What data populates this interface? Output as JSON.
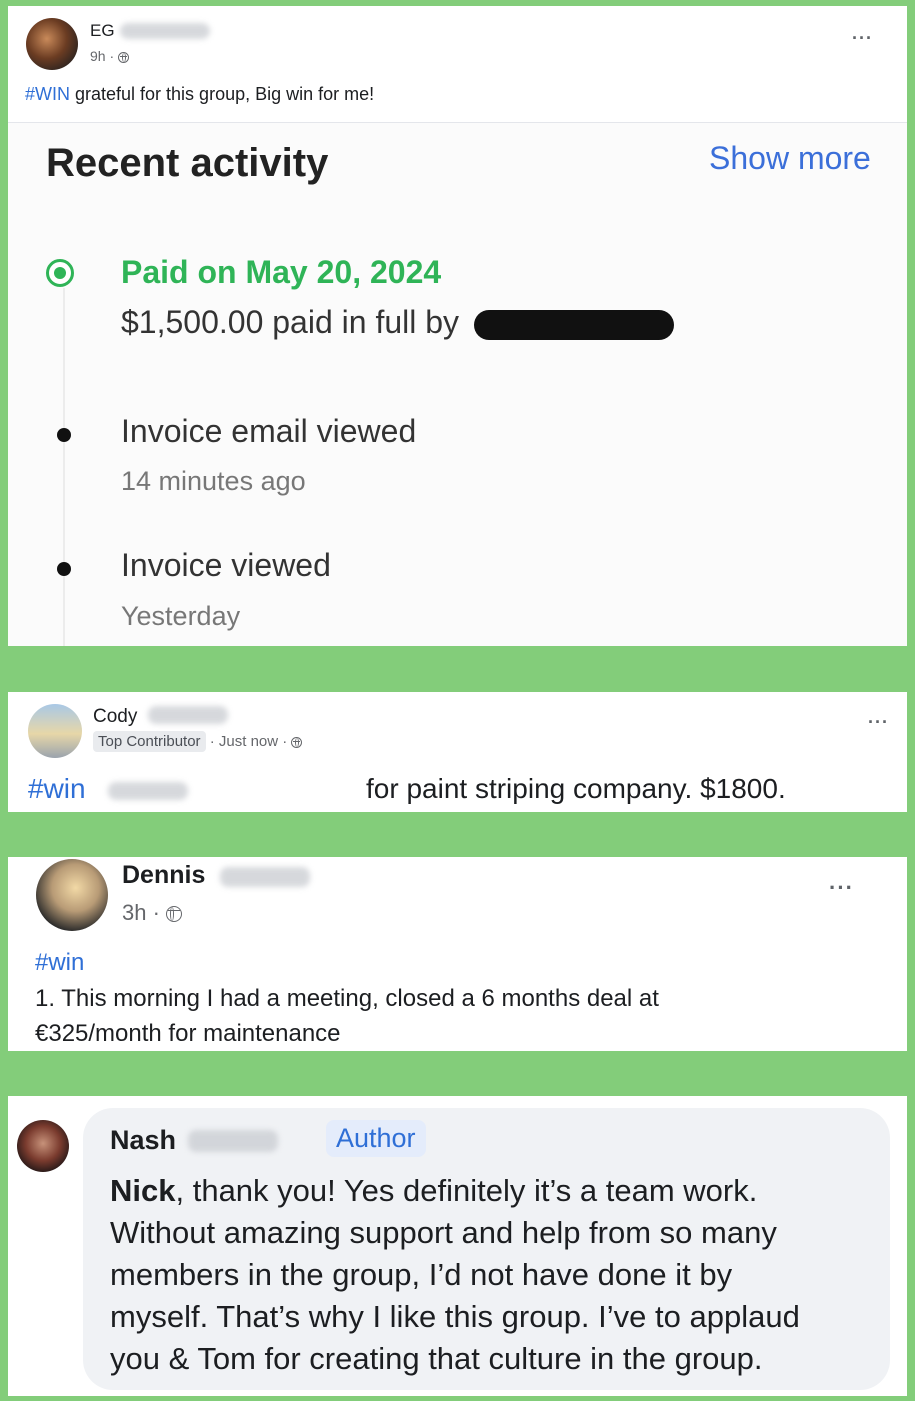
{
  "post_eg": {
    "author": "EG",
    "time": "9h ·",
    "hashtag": "#WIN",
    "text": " grateful for this group, Big win for me!",
    "more": "···"
  },
  "activity": {
    "title": "Recent activity",
    "show_more": "Show more",
    "items": [
      {
        "title": "Paid on May 20, 2024",
        "detail": "$1,500.00 paid in full by"
      },
      {
        "title": "Invoice email viewed",
        "detail": "14 minutes ago"
      },
      {
        "title": "Invoice viewed",
        "detail": "Yesterday"
      }
    ]
  },
  "post_cody": {
    "author": "Cody",
    "badge": "Top Contributor",
    "time": "· Just now ·",
    "hashtag": "#win",
    "text": "for paint striping company. $1800.",
    "more": "···"
  },
  "post_dennis": {
    "author": "Dennis",
    "time": "3h ·",
    "hashtag": "#win",
    "line1": "1. This morning I had a meeting, closed a 6 months deal at",
    "line2": "€325/month for maintenance",
    "more": "···"
  },
  "comment_nash": {
    "author": "Nash",
    "badge": "Author",
    "bold_name": "Nick",
    "lines": [
      ", thank you! Yes definitely it’s a team work.",
      "Without amazing support and help from so many",
      "members in the group, I’d not have done it by",
      "myself. That’s why I like this group. I’ve to applaud",
      "you & Tom for creating that culture in the group."
    ]
  },
  "colors": {
    "frame_green": "#83cd7a",
    "paid_green": "#2fb457",
    "link_blue": "#2f6fd6"
  }
}
